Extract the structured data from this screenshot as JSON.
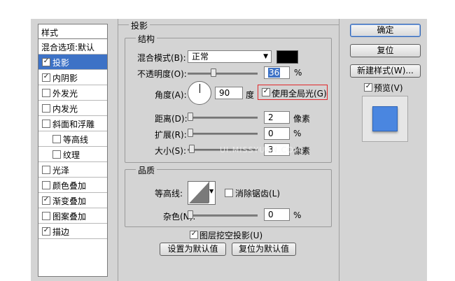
{
  "style_list": {
    "header": "样式",
    "items": [
      {
        "label": "混合选项:默认",
        "checkbox": false,
        "checked": false,
        "selected": false,
        "indent": false
      },
      {
        "label": "投影",
        "checkbox": true,
        "checked": true,
        "selected": true,
        "indent": false
      },
      {
        "label": "内阴影",
        "checkbox": true,
        "checked": true,
        "selected": false,
        "indent": false
      },
      {
        "label": "外发光",
        "checkbox": true,
        "checked": false,
        "selected": false,
        "indent": false
      },
      {
        "label": "内发光",
        "checkbox": true,
        "checked": false,
        "selected": false,
        "indent": false
      },
      {
        "label": "斜面和浮雕",
        "checkbox": true,
        "checked": false,
        "selected": false,
        "indent": false
      },
      {
        "label": "等高线",
        "checkbox": true,
        "checked": false,
        "selected": false,
        "indent": true
      },
      {
        "label": "纹理",
        "checkbox": true,
        "checked": false,
        "selected": false,
        "indent": true
      },
      {
        "label": "光泽",
        "checkbox": true,
        "checked": false,
        "selected": false,
        "indent": false
      },
      {
        "label": "颜色叠加",
        "checkbox": true,
        "checked": false,
        "selected": false,
        "indent": false
      },
      {
        "label": "渐变叠加",
        "checkbox": true,
        "checked": true,
        "selected": false,
        "indent": false
      },
      {
        "label": "图案叠加",
        "checkbox": true,
        "checked": false,
        "selected": false,
        "indent": false
      },
      {
        "label": "描边",
        "checkbox": true,
        "checked": true,
        "selected": false,
        "indent": false
      }
    ]
  },
  "panel": {
    "title": "投影",
    "structure": {
      "title": "结构",
      "blend_mode_label": "混合模式(B):",
      "blend_mode_value": "正常",
      "shadow_color": "#000000",
      "opacity_label": "不透明度(O):",
      "opacity_value": "36",
      "opacity_unit": "%",
      "angle_label": "角度(A):",
      "angle_value": "90",
      "angle_unit": "度",
      "global_light_label": "使用全局光(G)",
      "global_light_checked": true,
      "distance_label": "距离(D):",
      "distance_value": "2",
      "distance_unit": "像素",
      "spread_label": "扩展(R):",
      "spread_value": "0",
      "spread_unit": "%",
      "size_label": "大小(S):",
      "size_value": "3",
      "size_unit": "像素"
    },
    "quality": {
      "title": "品质",
      "contour_label": "等高线:",
      "antialias_label": "消除锯齿(L)",
      "antialias_checked": false,
      "noise_label": "杂色(N):",
      "noise_value": "0",
      "noise_unit": "%"
    },
    "knockout_label": "图层挖空投影(U)",
    "knockout_checked": true,
    "make_default_label": "设置为默认值",
    "reset_default_label": "复位为默认值"
  },
  "buttons": {
    "ok": "确定",
    "reset": "复位",
    "new_style": "新建样式(W)...",
    "preview_label": "预览(V)",
    "preview_checked": true
  },
  "colors": {
    "selection": "#3d72c6",
    "preview_swatch": "#4a86e0",
    "highlight_box": "#e0262a"
  },
  "watermark": "UI.MISSYUAN.COM"
}
